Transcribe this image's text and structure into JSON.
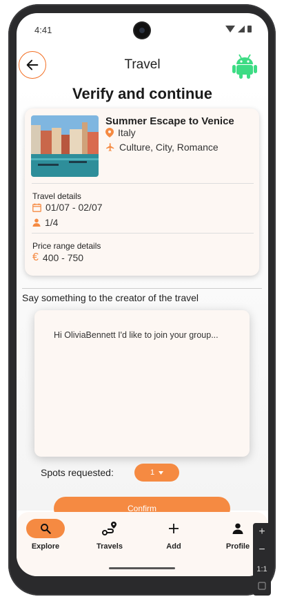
{
  "status": {
    "time": "4:41"
  },
  "appbar": {
    "title": "Travel"
  },
  "page": {
    "heading": "Verify and continue"
  },
  "trip": {
    "title": "Summer Escape to Venice",
    "country": "Italy",
    "tags": "Culture, City, Romance",
    "travel_details_label": "Travel details",
    "dates": "01/07 - 02/07",
    "spots": "1/4",
    "price_label": "Price range details",
    "price": "400 - 750"
  },
  "message": {
    "label": "Say something to the creator of the travel",
    "text": "Hi OliviaBennett I'd like to join your group..."
  },
  "spots_requested": {
    "label": "Spots requested:",
    "value": "1"
  },
  "confirm": {
    "label": "Confirm"
  },
  "nav": {
    "items": [
      {
        "label": "Explore",
        "icon": "search-icon"
      },
      {
        "label": "Travels",
        "icon": "route-icon"
      },
      {
        "label": "Add",
        "icon": "plus-icon"
      },
      {
        "label": "Profile",
        "icon": "person-icon"
      }
    ]
  },
  "emulator": {
    "zoom_label": "1:1"
  },
  "colors": {
    "accent": "#f58a42",
    "back_border": "#f26d21",
    "card_bg": "#fdf7f3"
  }
}
